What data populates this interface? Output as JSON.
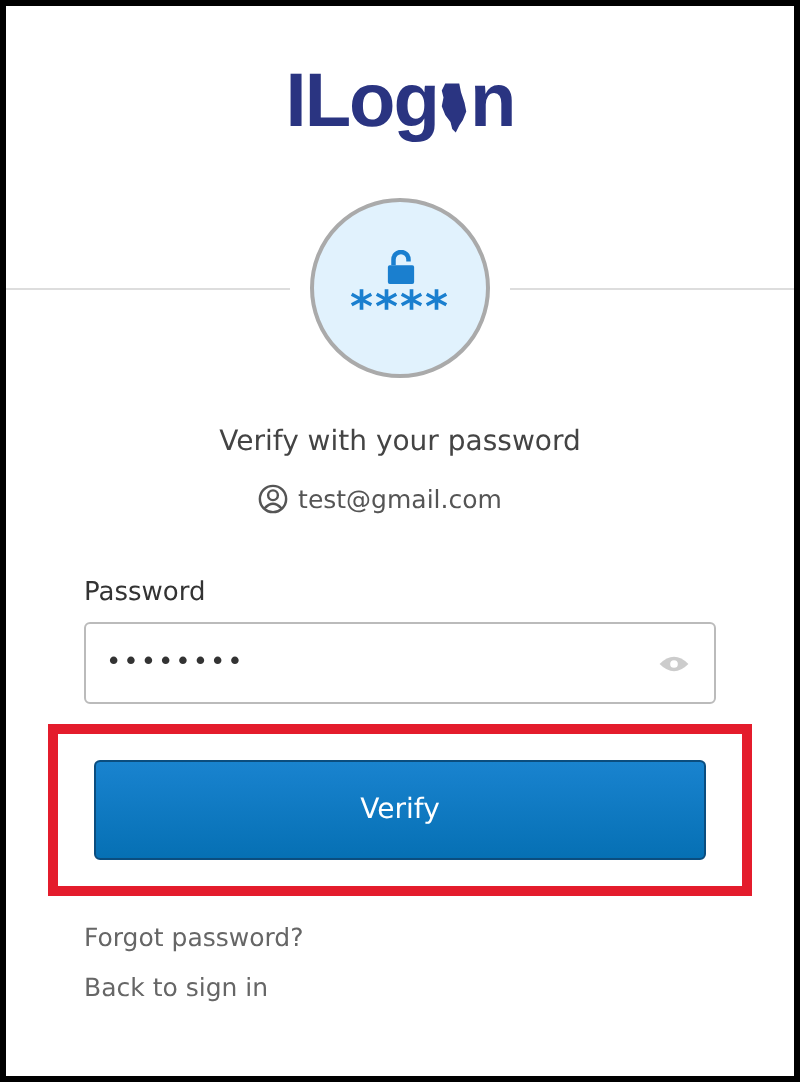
{
  "logo": {
    "before": "ILog",
    "after": "n"
  },
  "badge": {
    "text": "****"
  },
  "title": "Verify with your password",
  "account": {
    "email": "test@gmail.com"
  },
  "password": {
    "label": "Password",
    "value": "••••••••"
  },
  "verify_button": {
    "label": "Verify",
    "highlighted": true
  },
  "links": [
    "Forgot password?",
    "Back to sign in"
  ]
}
